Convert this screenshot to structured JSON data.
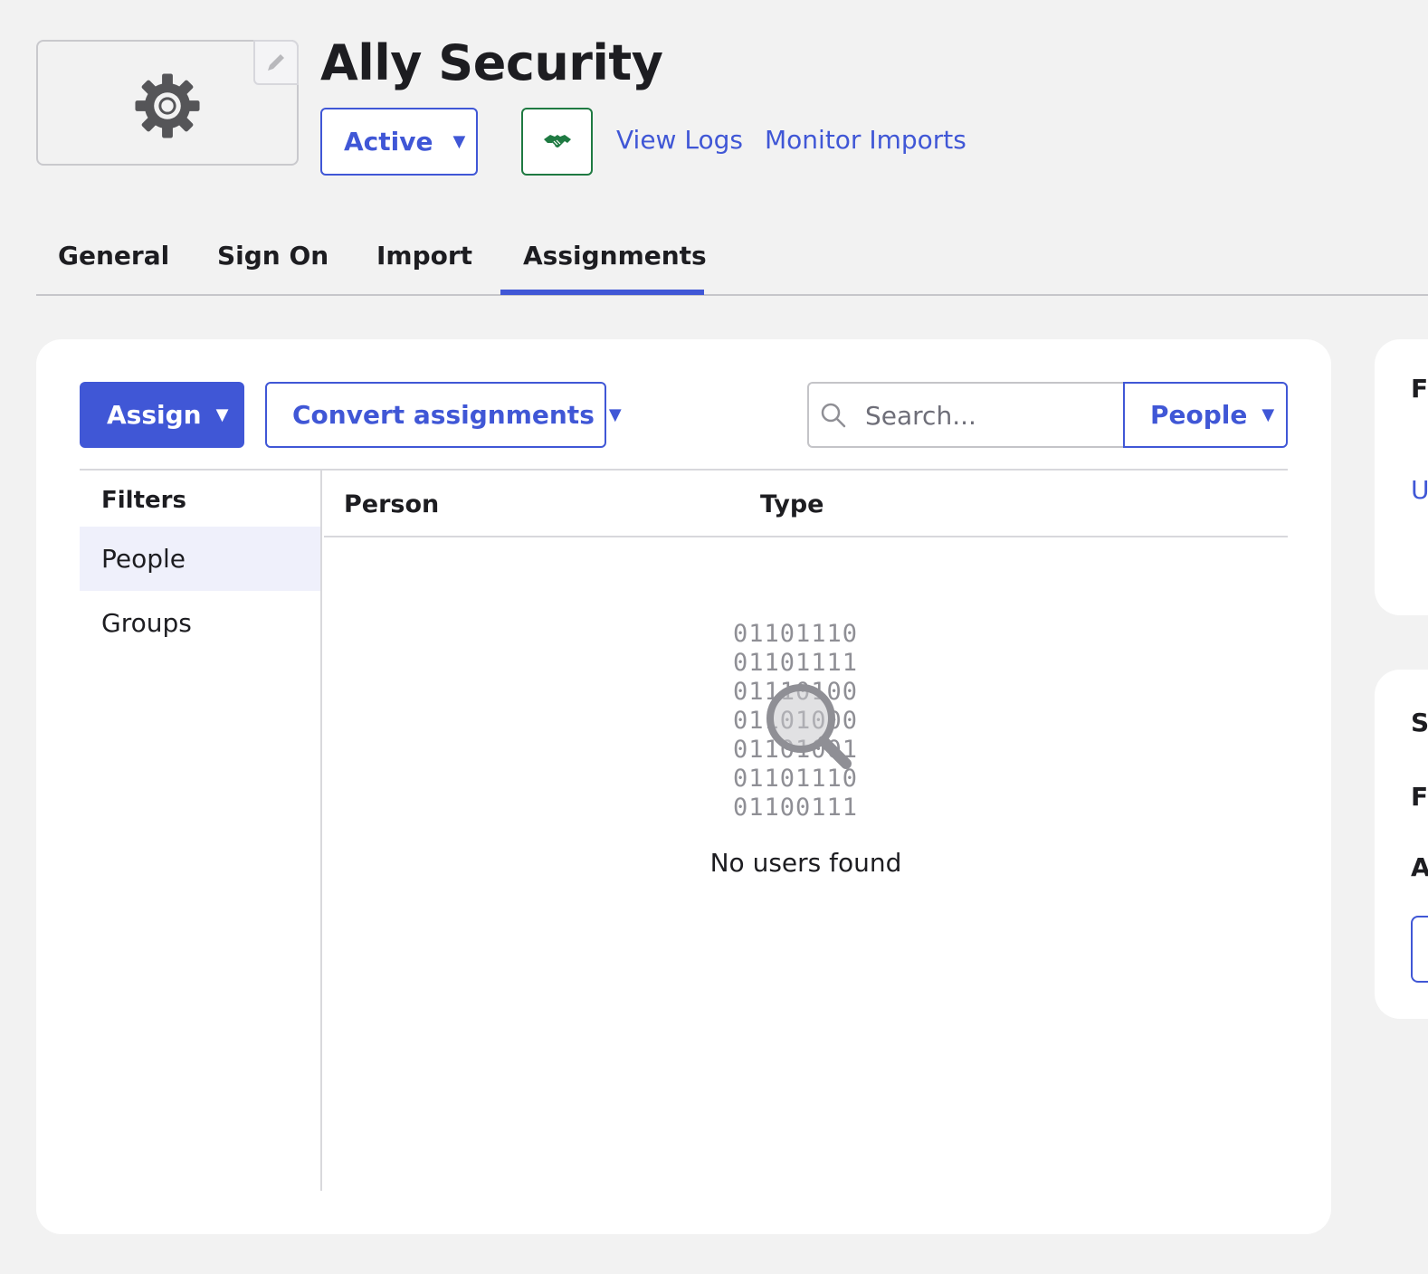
{
  "app": {
    "title": "Ally Security"
  },
  "header": {
    "status_label": "Active",
    "links": {
      "view_logs": "View Logs",
      "monitor_imports": "Monitor Imports"
    }
  },
  "tabs": [
    {
      "label": "General"
    },
    {
      "label": "Sign On"
    },
    {
      "label": "Import"
    },
    {
      "label": "Assignments"
    }
  ],
  "active_tab": "Assignments",
  "toolbar": {
    "assign_label": "Assign",
    "convert_label": "Convert assignments",
    "search_placeholder": "Search...",
    "search_value": "",
    "scope_label": "People"
  },
  "filters": {
    "heading": "Filters",
    "items": [
      {
        "label": "People"
      },
      {
        "label": "Groups"
      }
    ],
    "selected": "People"
  },
  "table": {
    "columns": [
      {
        "label": "Person"
      },
      {
        "label": "Type"
      }
    ],
    "rows": []
  },
  "empty_state": {
    "binary_lines": [
      "01101110",
      "01101111",
      "01110100",
      "01101000",
      "01101001",
      "01101110",
      "01100111"
    ],
    "message": "No users found"
  },
  "side_panel": {
    "card1_fragments": [
      "F",
      "U"
    ],
    "card2_fragments": [
      "S",
      "F",
      "A"
    ]
  },
  "colors": {
    "accent": "#4057d6",
    "background": "#f2f2f2",
    "surface": "#ffffff",
    "handshake_green": "#1f7a42",
    "selected_filter_bg": "#eff0fb"
  },
  "icons": {
    "app_logo": "gear-icon",
    "edit_logo": "pencil-icon",
    "handshake": "handshake-icon",
    "search": "search-icon",
    "empty_state": "magnifier-icon",
    "dropdown": "caret-down-icon"
  }
}
